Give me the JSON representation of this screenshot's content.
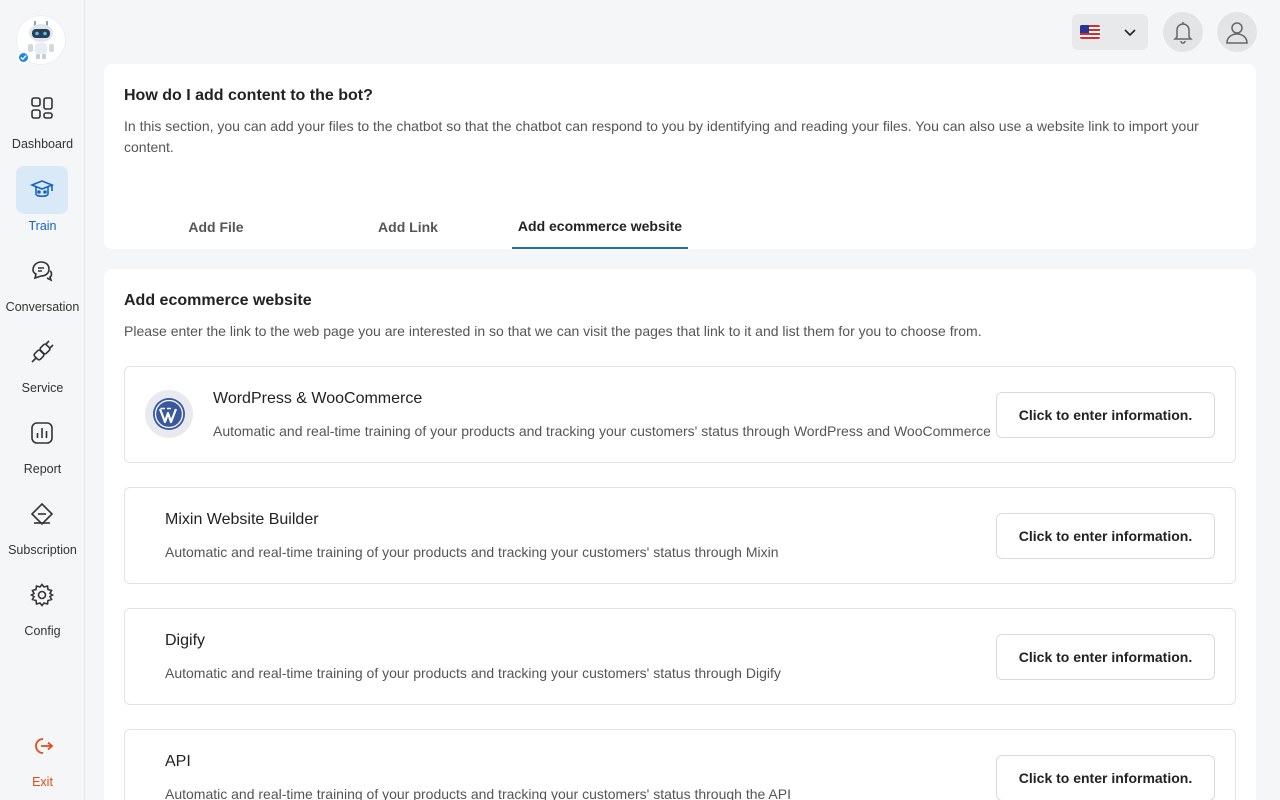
{
  "sidebar": {
    "items": [
      {
        "label": "Dashboard",
        "icon": "dashboard-icon"
      },
      {
        "label": "Train",
        "icon": "train-icon"
      },
      {
        "label": "Conversation",
        "icon": "conversation-icon"
      },
      {
        "label": "Service",
        "icon": "service-icon"
      },
      {
        "label": "Report",
        "icon": "report-icon"
      },
      {
        "label": "Subscription",
        "icon": "subscription-icon"
      },
      {
        "label": "Config",
        "icon": "gear-icon"
      }
    ],
    "active": "Train",
    "exit_label": "Exit"
  },
  "colors": {
    "accent": "#1e6fb8",
    "active_bg": "#d9e9f7",
    "exit": "#e64a19"
  },
  "header": {
    "language_flag": "us-flag-icon"
  },
  "intro": {
    "title": "How do I add content to the bot?",
    "description": "In this section, you can add your files to the chatbot so that the chatbot can respond to you by identifying and reading your files. You can also use a website link to import your content.",
    "tabs": [
      {
        "label": "Add File"
      },
      {
        "label": "Add Link"
      },
      {
        "label": "Add ecommerce website"
      }
    ],
    "active_tab": "Add ecommerce website"
  },
  "ecommerce": {
    "title": "Add ecommerce website",
    "description": "Please enter the link to the web page you are interested in so that we can visit the pages that link to it and list them for you to choose from.",
    "integrations": [
      {
        "name": "WordPress & WooCommerce",
        "description": "Automatic and real-time training of your products and tracking your customers' status through WordPress and WooCommerce",
        "button": "Click to enter information."
      },
      {
        "name": "Mixin Website Builder",
        "description": "Automatic and real-time training of your products and tracking your customers' status through Mixin",
        "button": "Click to enter information."
      },
      {
        "name": "Digify",
        "description": "Automatic and real-time training of your products and tracking your customers' status through Digify",
        "button": "Click to enter information."
      },
      {
        "name": "API",
        "description": "Automatic and real-time training of your products and tracking your customers' status through the API",
        "button": "Click to enter information."
      }
    ]
  }
}
